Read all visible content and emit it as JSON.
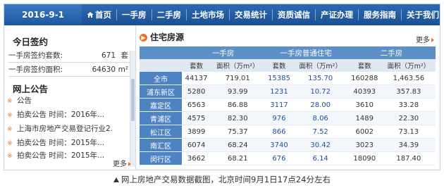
{
  "topbar": {
    "date": "2016-9-1",
    "nav": [
      "首页",
      "一手房",
      "二手房",
      "土地市场",
      "交易统计",
      "资质诚信",
      "产证办理",
      "服务指南",
      "关于我们"
    ]
  },
  "sidebar": {
    "sign_title": "今日签约",
    "sign_rows": [
      {
        "label": "一手房签约套数:",
        "value": "671",
        "unit": "套"
      },
      {
        "label": "一手房签约面积:",
        "value": "64630",
        "unit": "m²"
      }
    ],
    "announce_title": "网上公告",
    "announcements": [
      "公告",
      "拍卖公告 时间：2016年...",
      "上海市房地产交易登记行业2...",
      "拍卖公告 时间：2015年...",
      "拍卖公告 时间：2015年..."
    ],
    "more": "更多"
  },
  "main": {
    "title": "住宅房源",
    "more": "更多",
    "groups": [
      "一手房",
      "一手房普通住宅",
      "二手房"
    ],
    "subheaders": [
      "套数",
      "面积（万m²）",
      "套数",
      "面积（万m²）",
      "套数",
      "面积（万m²）"
    ],
    "rows": [
      {
        "name": "全市",
        "c": [
          "44137",
          "719.01",
          "15385",
          "135.70",
          "160288",
          "1,463.56"
        ]
      },
      {
        "name": "浦东新区",
        "c": [
          "5280",
          "93.99",
          "1231",
          "10.72",
          "40393",
          "357.83"
        ]
      },
      {
        "name": "嘉定区",
        "c": [
          "6563",
          "86.88",
          "3117",
          "28.00",
          "3610",
          "33.28"
        ]
      },
      {
        "name": "青浦区",
        "c": [
          "4575",
          "82.30",
          "976",
          "8.06",
          "1489",
          "22.30"
        ]
      },
      {
        "name": "松江区",
        "c": [
          "3899",
          "75.37",
          "866",
          "7.52",
          "6002",
          "73.13"
        ]
      },
      {
        "name": "南汇区",
        "c": [
          "6074",
          "68.24",
          "3740",
          "30.42",
          "3023",
          "34.39"
        ]
      },
      {
        "name": "闵行区",
        "c": [
          "3662",
          "68.21",
          "676",
          "6.14",
          "18090",
          "187.40"
        ]
      }
    ]
  },
  "caption": "网上房地产交易数据截图，北京时间9月1日17点24分左右",
  "colors": {
    "nav": "#1b4f93",
    "accent": "#e8742b",
    "header": "#5d8fc9"
  }
}
